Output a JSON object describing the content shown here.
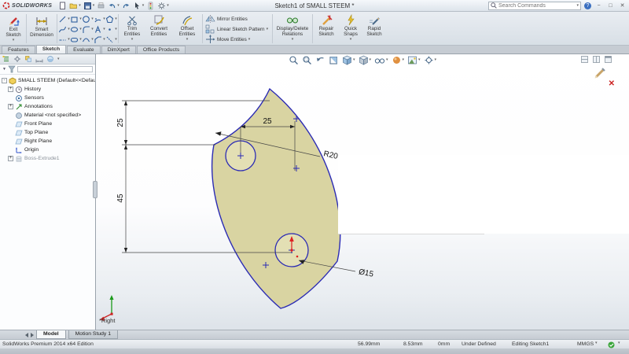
{
  "title_bar": {
    "logo_text": "SOLIDWORKS",
    "title": "Sketch1 of SMALL STEEM *",
    "search_placeholder": "Search Commands"
  },
  "icons": {
    "caret": "▾",
    "plus": "+",
    "minus": "-",
    "help": "?",
    "minimize": "−",
    "maximize": "□",
    "close": "✕",
    "cancel_sketch": "✕",
    "filter_caret": "▼"
  },
  "ribbon": {
    "exit_sketch": "Exit Sketch",
    "smart_dimension": "Smart Dimension",
    "trim_entities": "Trim Entities",
    "convert_entities": "Convert Entities",
    "offset_entities": "Offset Entities",
    "mirror_entities": "Mirror Entities",
    "linear_sketch_pattern": "Linear Sketch Pattern",
    "move_entities": "Move Entities",
    "display_delete_relations": "Display/Delete Relations",
    "repair_sketch": "Repair Sketch",
    "quick_snaps": "Quick Snaps",
    "rapid_sketch": "Rapid Sketch"
  },
  "command_tabs": [
    {
      "label": "Features",
      "active": false
    },
    {
      "label": "Sketch",
      "active": true
    },
    {
      "label": "Evaluate",
      "active": false
    },
    {
      "label": "DimXpert",
      "active": false
    },
    {
      "label": "Office Products",
      "active": false
    }
  ],
  "feature_tree": {
    "items": [
      "SMALL STEEM (Default<<Defau",
      "History",
      "Sensors",
      "Annotations",
      "Material <not specified>",
      "Front Plane",
      "Top Plane",
      "Right Plane",
      "Origin",
      "Boss-Extrude1"
    ]
  },
  "viewport": {
    "view_label": "*Right",
    "dimensions": {
      "upper_height": "25",
      "top_width": "25",
      "lower_height": "45",
      "radius": "R20",
      "diameter": "Ø15"
    }
  },
  "document_tabs": [
    {
      "label": "Model",
      "active": true
    },
    {
      "label": "Motion Study 1",
      "active": false
    }
  ],
  "status_bar": {
    "edition": "SolidWorks Premium 2014 x64 Edition",
    "coord_x": "56.99mm",
    "coord_y": "8.53mm",
    "coord_z": "0mm",
    "definition_state": "Under Defined",
    "mode": "Editing Sketch1",
    "units": "MMGS"
  }
}
